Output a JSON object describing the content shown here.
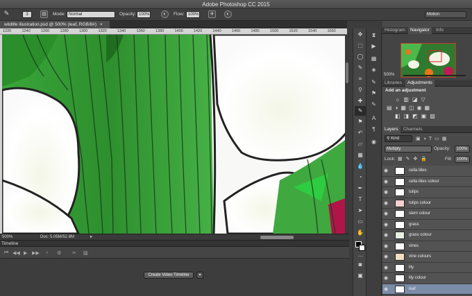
{
  "app_title": "Adobe Photoshop CC 2015",
  "options_bar": {
    "brush_size": "3",
    "mode_label": "Mode:",
    "mode_value": "Normal",
    "opacity_label": "Opacity:",
    "opacity_value": "100%",
    "flow_label": "Flow:",
    "flow_value": "100%",
    "workspace": "Motion"
  },
  "document": {
    "tab_title": "wildlife illustration.psd @ 500% (leaf, RGB/8#)",
    "ruler_ticks": [
      "1220",
      "1240",
      "1260",
      "1280",
      "1300",
      "1320",
      "1340",
      "1360",
      "1380",
      "1400",
      "1420",
      "1440",
      "1460",
      "1480",
      "1500",
      "1520",
      "1540",
      "1560"
    ],
    "zoom": "500%",
    "doc_size": "Doc: 5.05M/52.8M"
  },
  "timeline": {
    "title": "Timeline",
    "create_button": "Create Video Timeline"
  },
  "navigator": {
    "tabs": [
      "Histogram",
      "Navigator",
      "Info"
    ],
    "active_tab": "Navigator",
    "zoom": "500%"
  },
  "adjustments": {
    "tabs": [
      "Libraries",
      "Adjustments"
    ],
    "active_tab": "Adjustments",
    "heading": "Add an adjustment"
  },
  "layers_panel": {
    "tabs": [
      "Layers",
      "Channels"
    ],
    "active_tab": "Layers",
    "kind_label": "Kind",
    "blend_mode": "Multiply",
    "opacity_label": "Opacity:",
    "opacity_value": "100%",
    "lock_label": "Lock:",
    "fill_label": "Fill:",
    "fill_value": "100%",
    "layers": [
      {
        "name": "cella lilies"
      },
      {
        "name": "cella lilies colour"
      },
      {
        "name": "tulips"
      },
      {
        "name": "tulips colour"
      },
      {
        "name": "stem colour"
      },
      {
        "name": "grass"
      },
      {
        "name": "grass colour"
      },
      {
        "name": "vines"
      },
      {
        "name": "vine colours"
      },
      {
        "name": "lily"
      },
      {
        "name": "lily colour"
      },
      {
        "name": "leaf",
        "selected": true
      }
    ]
  }
}
